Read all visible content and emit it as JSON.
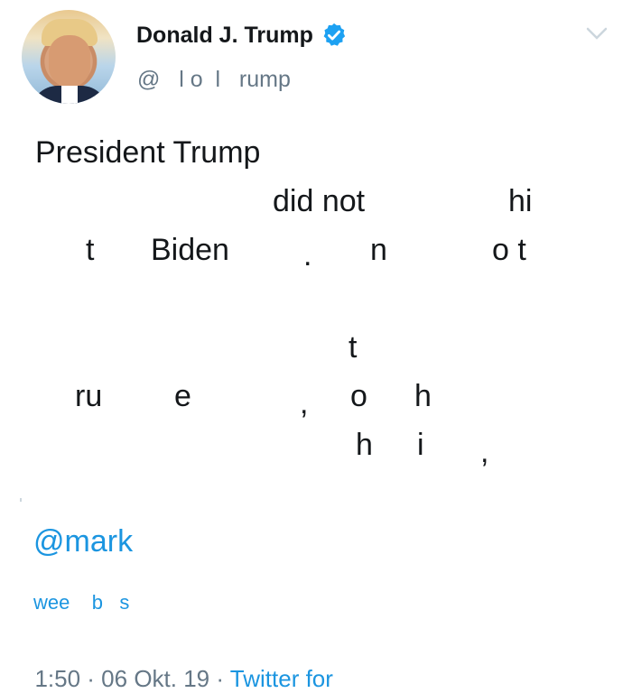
{
  "profile": {
    "name": "Donald J. Trump",
    "handle": "@   l o  l   rump",
    "verified_color": "#1da1f2"
  },
  "tweet": {
    "lines": [
      "President Trump",
      "did not",
      "hi",
      "t",
      "Biden",
      ".",
      "n",
      "o t",
      "t",
      "ru",
      "e",
      ",",
      "o",
      "h",
      "h",
      "i",
      ","
    ],
    "mention": "@mark",
    "footer_link": "wee    b   s"
  },
  "meta": {
    "time": "1:50",
    "sep1": " · ",
    "date": "06 Okt. 19",
    "sep2": " · ",
    "source": "Twitter for"
  },
  "colors": {
    "link": "#1b95e0",
    "secondary": "#657786",
    "text": "#14171a"
  }
}
